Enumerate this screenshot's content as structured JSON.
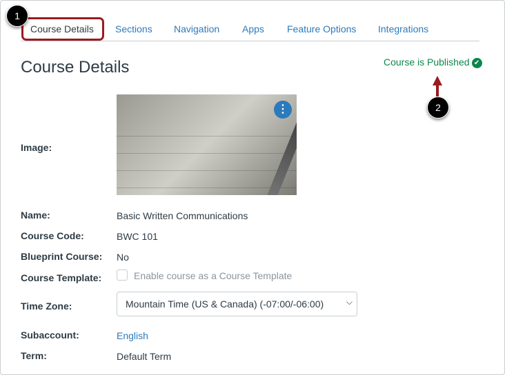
{
  "tabs": [
    "Course Details",
    "Sections",
    "Navigation",
    "Apps",
    "Feature Options",
    "Integrations"
  ],
  "callouts": [
    "1",
    "2"
  ],
  "title": "Course Details",
  "status": "Course is Published",
  "fields": {
    "image_label": "Image:",
    "name_label": "Name:",
    "name": "Basic Written Communications",
    "code_label": "Course Code:",
    "code": "BWC 101",
    "blueprint_label": "Blueprint Course:",
    "blueprint": "No",
    "template_label": "Course Template:",
    "template_checkbox": "Enable course as a Course Template",
    "timezone_label": "Time Zone:",
    "timezone": "Mountain Time (US & Canada) (-07:00/-06:00)",
    "subaccount_label": "Subaccount:",
    "subaccount": "English",
    "term_label": "Term:",
    "term": "Default Term"
  }
}
